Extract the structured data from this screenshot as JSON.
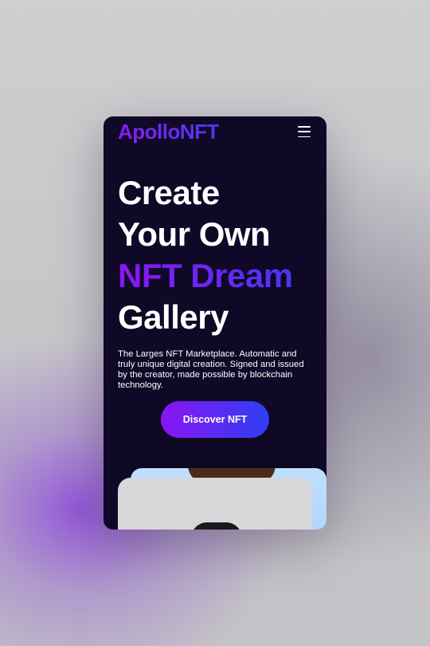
{
  "brand": {
    "name": "ApolloNFT"
  },
  "nav": {
    "menu_icon": "hamburger-menu-icon"
  },
  "hero": {
    "line1": "Create",
    "line2": "Your Own",
    "line3": "NFT Dream",
    "line4": "Gallery",
    "description": "The Larges NFT Marketplace. Automatic and truly unique digital creation. Signed and issued by the creator, made possible by blockchain technology.",
    "cta_label": "Discover NFT"
  },
  "colors": {
    "background_dark": "#0f0826",
    "accent_purple": "#8a14f2",
    "accent_blue": "#2e3ff4",
    "card_light_blue": "#bfe0ff",
    "card_grey": "#d7d7d9"
  }
}
